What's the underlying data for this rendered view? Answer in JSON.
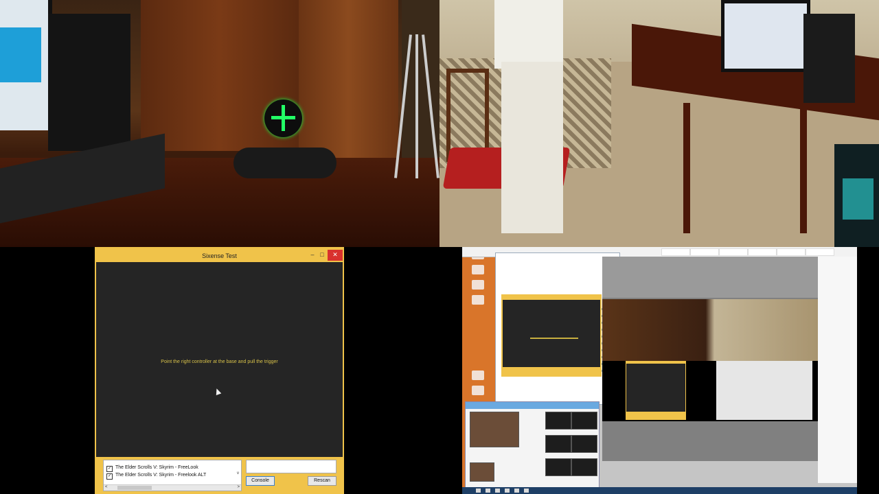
{
  "sixense_window": {
    "title": "Sixense Test",
    "controls": {
      "minimize": "–",
      "maximize": "□",
      "close": "✕"
    },
    "message": "Point the right controller at the base and pull the trigger",
    "profiles": [
      {
        "label": "The Elder Scrolls V: Skyrim - FreeLook",
        "checked": true
      },
      {
        "label": "The Elder Scrolls V: Skyrim - Freelook ALT",
        "checked": true
      }
    ],
    "scroll_left": "<",
    "scroll_right": ">",
    "scroll_down": "v",
    "console_button": "Console",
    "rescan_button": "Rescan"
  },
  "colors": {
    "window_accent": "#f0c34a",
    "window_body": "#252525",
    "message_text": "#d8c24a",
    "close_button": "#d9312d",
    "orb_glow": "#22ff66"
  },
  "icons": {
    "checkbox": "✓",
    "cursor": "arrow-cursor-icon"
  }
}
